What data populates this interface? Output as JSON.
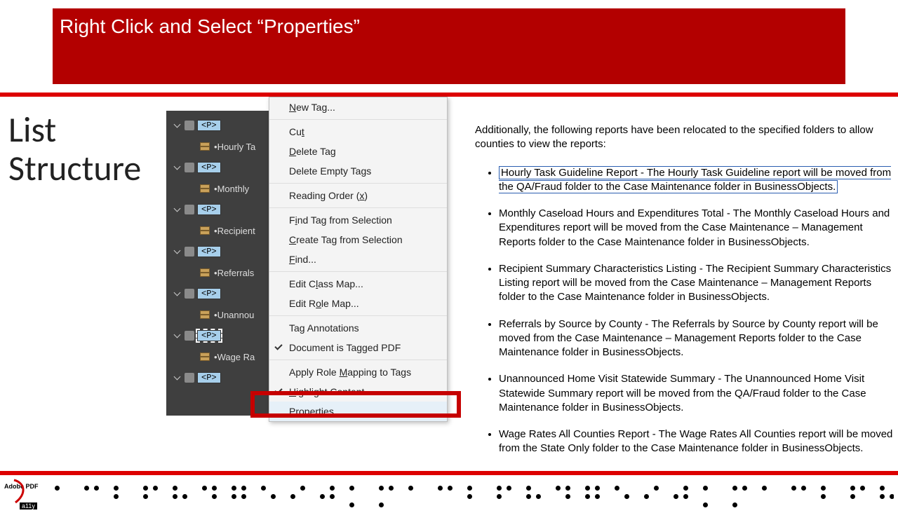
{
  "banner": {
    "title": "Right Click and Select “Properties”"
  },
  "side_title_1": "List",
  "side_title_2": "Structure",
  "tags": {
    "p_label": "<P>",
    "items": [
      "Hourly Ta",
      "Monthly",
      "Recipient",
      "Referrals",
      "Unannou",
      "Wage Ra"
    ]
  },
  "ctx": {
    "new_tag": "New Tag...",
    "cut": "Cut",
    "delete_tag": "Delete Tag",
    "delete_empty": "Delete Empty Tags",
    "reading_order": "Reading Order (x)",
    "find_from_sel": "Find Tag from Selection",
    "create_from_sel": "Create Tag from Selection",
    "find": "Find...",
    "edit_class": "Edit Class Map...",
    "edit_role": "Edit Role Map...",
    "tag_ann": "Tag Annotations",
    "doc_tagged": "Document is Tagged PDF",
    "apply_role": "Apply Role Mapping to Tags",
    "highlight": "Highlight Content",
    "properties": "Properties..."
  },
  "doc": {
    "intro": "Additionally, the following reports have been relocated to the specified folders to allow counties to view the reports:",
    "bullets": [
      "Hourly Task Guideline Report - The Hourly Task Guideline report will be moved from the QA/Fraud folder to the Case Maintenance folder in BusinessObjects.",
      "Monthly Caseload Hours and Expenditures Total - The Monthly Caseload Hours and Expenditures report will be moved from the Case Maintenance – Management Reports folder to the Case Maintenance folder in BusinessObjects.",
      "Recipient Summary Characteristics Listing - The Recipient Summary Characteristics Listing report will be moved from the Case Maintenance – Management Reports folder to the Case Maintenance folder in BusinessObjects.",
      "Referrals by Source by County - The Referrals by Source by County report will be moved from the Case Maintenance – Management Reports folder to the Case Maintenance folder in BusinessObjects.",
      "Unannounced Home Visit Statewide Summary - The Unannounced Home Visit Statewide Summary report will be moved from the QA/Fraud folder to the Case Maintenance folder in BusinessObjects.",
      "Wage Rates All Counties Report - The Wage Rates All Counties report will be moved from the State Only folder to the Case Maintenance folder in BusinessObjects."
    ]
  },
  "logo": {
    "line1": "Adobe PDF",
    "line2": "a11y"
  }
}
